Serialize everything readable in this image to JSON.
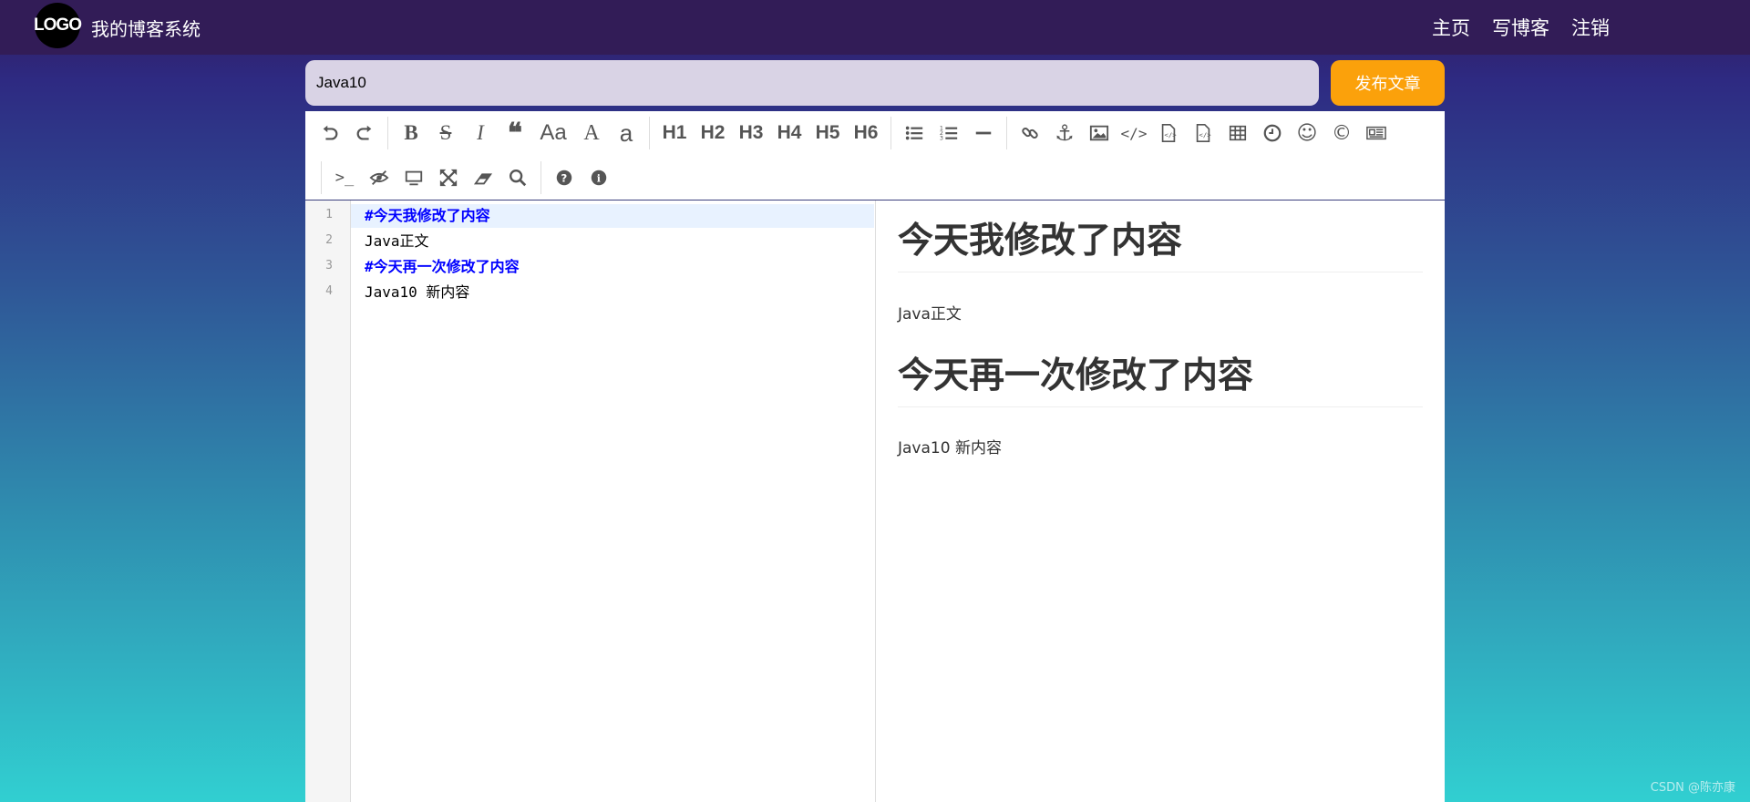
{
  "nav": {
    "logo_text": "LOGO",
    "site_title": "我的博客系统",
    "links": [
      "主页",
      "写博客",
      "注销"
    ]
  },
  "editor": {
    "title_value": "Java10",
    "publish_label": "发布文章",
    "toolbar": {
      "row1": [
        "undo-icon",
        "redo-icon",
        "bold-icon",
        "strikethrough-icon",
        "italic-icon",
        "quote-icon",
        "uppercase-icon",
        "ucwords-icon",
        "lowercase-icon",
        "H1",
        "H2",
        "H3",
        "H4",
        "H5",
        "H6",
        "list-ul-icon",
        "list-ol-icon",
        "hr-icon",
        "link-icon",
        "anchor-icon",
        "image-icon",
        "code-icon",
        "preformatted-text-icon",
        "code-block-icon",
        "table-icon",
        "datetime-icon",
        "emoji-icon",
        "html-entities-icon",
        "pagebreak-icon"
      ],
      "row2": [
        "goto-line-icon",
        "watch-icon",
        "preview-icon",
        "fullscreen-icon",
        "clear-icon",
        "search-icon",
        "help-icon",
        "info-icon"
      ]
    },
    "code_lines": [
      {
        "num": "1",
        "text": "#今天我修改了内容"
      },
      {
        "num": "2",
        "text": "Java正文"
      },
      {
        "num": "3",
        "text": "#今天再一次修改了内容"
      },
      {
        "num": "4",
        "text": "Java10 新内容"
      }
    ],
    "preview": {
      "h1_1": "今天我修改了内容",
      "p_1": "Java正文",
      "h1_2": "今天再一次修改了内容",
      "p_2": "Java10 新内容"
    }
  },
  "watermark": "CSDN @陈亦康",
  "colors": {
    "nav_bg": "#321c57",
    "publish_bg": "#fba10b",
    "header_code": "#0000ff"
  }
}
